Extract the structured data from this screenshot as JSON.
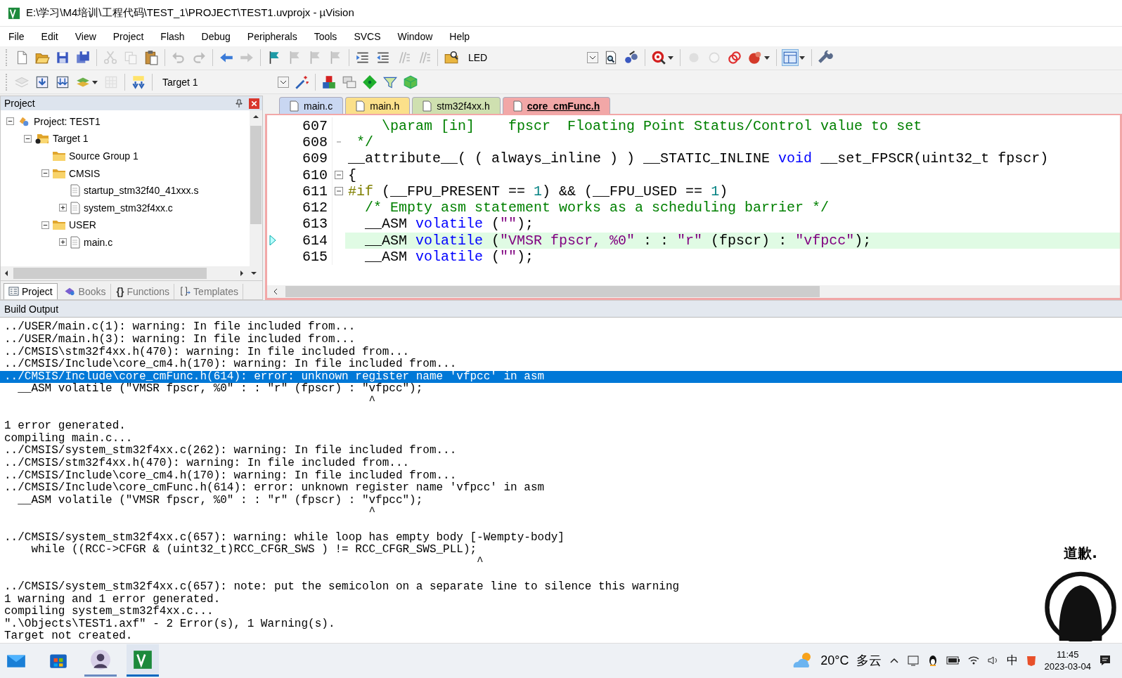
{
  "window": {
    "title": "E:\\学习\\M4培训\\工程代码\\TEST_1\\PROJECT\\TEST1.uvprojx - µVision"
  },
  "menu": [
    "File",
    "Edit",
    "View",
    "Project",
    "Flash",
    "Debug",
    "Peripherals",
    "Tools",
    "SVCS",
    "Window",
    "Help"
  ],
  "toolbars": [
    {
      "items": [
        {
          "kind": "doc",
          "disabled": false
        },
        {
          "kind": "folder-open",
          "disabled": false
        },
        {
          "kind": "disk",
          "disabled": false
        },
        {
          "kind": "disks",
          "disabled": false
        },
        {
          "kind": "separator"
        },
        {
          "kind": "scissors",
          "disabled": true
        },
        {
          "kind": "pages",
          "disabled": true
        },
        {
          "kind": "clipboard",
          "disabled": false
        },
        {
          "kind": "separator"
        },
        {
          "kind": "undo",
          "disabled": true
        },
        {
          "kind": "redo",
          "disabled": true
        },
        {
          "kind": "separator"
        },
        {
          "kind": "arrow-left",
          "disabled": false
        },
        {
          "kind": "arrow-right",
          "disabled": true
        },
        {
          "kind": "separator"
        },
        {
          "kind": "flag",
          "disabled": false
        },
        {
          "kind": "flag",
          "disabled": true
        },
        {
          "kind": "flag",
          "disabled": true
        },
        {
          "kind": "flag",
          "disabled": true
        },
        {
          "kind": "separator"
        },
        {
          "kind": "indent",
          "disabled": false
        },
        {
          "kind": "outdent",
          "disabled": false
        },
        {
          "kind": "comment",
          "disabled": true
        },
        {
          "kind": "comment",
          "disabled": true
        },
        {
          "kind": "separator"
        },
        {
          "kind": "folder-find",
          "disabled": false
        },
        {
          "kind": "combo",
          "value": "LED"
        },
        {
          "kind": "doc-find",
          "disabled": false
        },
        {
          "kind": "tool",
          "disabled": false
        },
        {
          "kind": "separator"
        },
        {
          "kind": "debug",
          "disabled": false
        },
        {
          "kind": "caret",
          "disabled": false
        },
        {
          "kind": "separator"
        },
        {
          "kind": "dot",
          "disabled": true
        },
        {
          "kind": "ring",
          "disabled": true
        },
        {
          "kind": "rings",
          "disabled": false
        },
        {
          "kind": "bug",
          "disabled": false
        },
        {
          "kind": "caret",
          "disabled": false
        },
        {
          "kind": "separator"
        },
        {
          "kind": "layout",
          "disabled": false
        },
        {
          "kind": "caret",
          "disabled": false
        },
        {
          "kind": "separator"
        },
        {
          "kind": "wrench",
          "disabled": false
        }
      ]
    },
    {
      "items": [
        {
          "kind": "stack",
          "disabled": true
        },
        {
          "kind": "download",
          "disabled": false
        },
        {
          "kind": "download2",
          "disabled": false
        },
        {
          "kind": "stack-color",
          "disabled": false
        },
        {
          "kind": "caret",
          "disabled": false
        },
        {
          "kind": "grid",
          "disabled": true
        },
        {
          "kind": "separator"
        },
        {
          "kind": "load",
          "disabled": false
        },
        {
          "kind": "separator"
        },
        {
          "kind": "combo",
          "value": "Target 1"
        },
        {
          "kind": "wand",
          "disabled": false
        },
        {
          "kind": "separator"
        },
        {
          "kind": "blocks",
          "disabled": false
        },
        {
          "kind": "windows",
          "disabled": false
        },
        {
          "kind": "diamond",
          "disabled": false
        },
        {
          "kind": "funnel",
          "disabled": false
        },
        {
          "kind": "cube",
          "disabled": false
        }
      ]
    }
  ],
  "project": {
    "title": "Project",
    "tree": [
      {
        "label": "Project: TEST1",
        "kind": "project",
        "expanded": true,
        "children": [
          {
            "label": "Target 1",
            "kind": "target",
            "expanded": true,
            "children": [
              {
                "label": "Source Group 1",
                "kind": "group"
              },
              {
                "label": "CMSIS",
                "kind": "group",
                "expanded": true,
                "children": [
                  {
                    "label": "startup_stm32f40_41xxx.s",
                    "kind": "file"
                  },
                  {
                    "label": "system_stm32f4xx.c",
                    "kind": "file",
                    "expanded": false
                  }
                ]
              },
              {
                "label": "USER",
                "kind": "group",
                "expanded": true,
                "children": [
                  {
                    "label": "main.c",
                    "kind": "file",
                    "expanded": false
                  }
                ]
              }
            ]
          }
        ]
      }
    ],
    "tabs": [
      {
        "label": "Project",
        "kind": "project",
        "selected": true
      },
      {
        "label": "Books",
        "kind": "books",
        "selected": false
      },
      {
        "label": "Functions",
        "kind": "functions",
        "glyph": "{}",
        "selected": false
      },
      {
        "label": "Templates",
        "kind": "templates",
        "selected": false
      }
    ]
  },
  "editor": {
    "tabs": [
      {
        "label": "main.c",
        "color": "#c9d7f2",
        "selected": false
      },
      {
        "label": "main.h",
        "color": "#fbe08a",
        "selected": false
      },
      {
        "label": "stm32f4xx.h",
        "color": "#cfe0b0",
        "selected": false
      },
      {
        "label": "core_cmFunc.h",
        "color": "#f2a7a7",
        "selected": true
      }
    ],
    "lines": [
      {
        "number": "607",
        "tokens": [
          {
            "kind": "comment",
            "text": "    \\param [in]    fpscr  Floating Point Status/Control value to set"
          }
        ]
      },
      {
        "number": "608",
        "fold_end": true,
        "tokens": [
          {
            "kind": "comment",
            "text": " */"
          }
        ]
      },
      {
        "number": "609",
        "tokens": [
          {
            "kind": "plain",
            "text": "__attribute__( ( always_inline ) ) __STATIC_INLINE "
          },
          {
            "kind": "keyword",
            "text": "void"
          },
          {
            "kind": "plain",
            "text": " __set_FPSCR(uint32_t fpscr)"
          }
        ]
      },
      {
        "number": "610",
        "fold_start": true,
        "tokens": [
          {
            "kind": "plain",
            "text": "{"
          }
        ]
      },
      {
        "number": "611",
        "fold_start": true,
        "tokens": [
          {
            "kind": "preproc",
            "text": "#if"
          },
          {
            "kind": "plain",
            "text": " (__FPU_PRESENT == "
          },
          {
            "kind": "number",
            "text": "1"
          },
          {
            "kind": "plain",
            "text": ") && (__FPU_USED == "
          },
          {
            "kind": "number",
            "text": "1"
          },
          {
            "kind": "plain",
            "text": ")"
          }
        ]
      },
      {
        "number": "612",
        "tokens": [
          {
            "kind": "comment",
            "text": "  /* Empty asm statement works as a scheduling barrier */"
          }
        ]
      },
      {
        "number": "613",
        "tokens": [
          {
            "kind": "plain",
            "text": "  __ASM "
          },
          {
            "kind": "keyword",
            "text": "volatile"
          },
          {
            "kind": "plain",
            "text": " ("
          },
          {
            "kind": "string",
            "text": "\"\""
          },
          {
            "kind": "plain",
            "text": ");"
          }
        ]
      },
      {
        "number": "614",
        "current": true,
        "tokens": [
          {
            "kind": "plain",
            "text": "  __ASM "
          },
          {
            "kind": "keyword",
            "text": "volatile"
          },
          {
            "kind": "plain",
            "text": " ("
          },
          {
            "kind": "string",
            "text": "\"VMSR fpscr, %0\""
          },
          {
            "kind": "plain",
            "text": " : : "
          },
          {
            "kind": "string",
            "text": "\"r\""
          },
          {
            "kind": "plain",
            "text": " (fpscr) : "
          },
          {
            "kind": "string",
            "text": "\"vfpcc\""
          },
          {
            "kind": "plain",
            "text": ");"
          }
        ]
      },
      {
        "number": "615",
        "tokens": [
          {
            "kind": "plain",
            "text": "  __ASM "
          },
          {
            "kind": "keyword",
            "text": "volatile"
          },
          {
            "kind": "plain",
            "text": " ("
          },
          {
            "kind": "string",
            "text": "\"\""
          },
          {
            "kind": "plain",
            "text": ");"
          }
        ]
      }
    ]
  },
  "build_output": {
    "title": "Build Output",
    "lines": [
      {
        "kind": "text",
        "text": "../USER/main.c(1): warning: In file included from...",
        "selected": false
      },
      {
        "kind": "text",
        "text": "../USER/main.h(3): warning: In file included from...",
        "selected": false
      },
      {
        "kind": "text",
        "text": "../CMSIS\\stm32f4xx.h(470): warning: In file included from...",
        "selected": false
      },
      {
        "kind": "text",
        "text": "../CMSIS/Include\\core_cm4.h(170): warning: In file included from...",
        "selected": false
      },
      {
        "kind": "text",
        "text": "../CMSIS/Include\\core_cmFunc.h(614): error: unknown register name 'vfpcc' in asm",
        "selected": true
      },
      {
        "kind": "text",
        "text": "  __ASM volatile (\"VMSR fpscr, %0\" : : \"r\" (fpscr) : \"vfpcc\");",
        "selected": false
      },
      {
        "kind": "text",
        "text": "                                                      ^",
        "selected": false
      },
      {
        "kind": "blank"
      },
      {
        "kind": "text",
        "text": "1 error generated.",
        "selected": false
      },
      {
        "kind": "text",
        "text": "compiling main.c...",
        "selected": false
      },
      {
        "kind": "text",
        "text": "../CMSIS/system_stm32f4xx.c(262): warning: In file included from...",
        "selected": false
      },
      {
        "kind": "text",
        "text": "../CMSIS/stm32f4xx.h(470): warning: In file included from...",
        "selected": false
      },
      {
        "kind": "text",
        "text": "../CMSIS/Include\\core_cm4.h(170): warning: In file included from...",
        "selected": false
      },
      {
        "kind": "text",
        "text": "../CMSIS/Include\\core_cmFunc.h(614): error: unknown register name 'vfpcc' in asm",
        "selected": false
      },
      {
        "kind": "text",
        "text": "  __ASM volatile (\"VMSR fpscr, %0\" : : \"r\" (fpscr) : \"vfpcc\");",
        "selected": false
      },
      {
        "kind": "text",
        "text": "                                                      ^",
        "selected": false
      },
      {
        "kind": "blank"
      },
      {
        "kind": "text",
        "text": "../CMSIS/system_stm32f4xx.c(657): warning: while loop has empty body [-Wempty-body]",
        "selected": false
      },
      {
        "kind": "text",
        "text": "    while ((RCC->CFGR & (uint32_t)RCC_CFGR_SWS ) != RCC_CFGR_SWS_PLL);",
        "selected": false
      },
      {
        "kind": "text",
        "text": "                                                                      ^",
        "selected": false
      },
      {
        "kind": "blank"
      },
      {
        "kind": "text",
        "text": "../CMSIS/system_stm32f4xx.c(657): note: put the semicolon on a separate line to silence this warning",
        "selected": false
      },
      {
        "kind": "text",
        "text": "1 warning and 1 error generated.",
        "selected": false
      },
      {
        "kind": "text",
        "text": "compiling system_stm32f4xx.c...",
        "selected": false
      },
      {
        "kind": "text",
        "text": "\".\\Objects\\TEST1.axf\" - 2 Error(s), 1 Warning(s).",
        "selected": false
      },
      {
        "kind": "text",
        "text": "Target not created.",
        "selected": false
      }
    ]
  },
  "sticker": {
    "caption": "道歉."
  },
  "taskbar": {
    "apps": [
      {
        "kind": "mail",
        "running": false,
        "selected": false
      },
      {
        "kind": "store",
        "running": false,
        "selected": false
      },
      {
        "kind": "avatar",
        "running": true,
        "selected": false
      },
      {
        "kind": "uvision",
        "running": true,
        "selected": true
      }
    ],
    "weather": {
      "temperature": "20°C",
      "condition": "多云"
    },
    "ime": "中",
    "time": "11:45",
    "date": "2023-03-04"
  }
}
